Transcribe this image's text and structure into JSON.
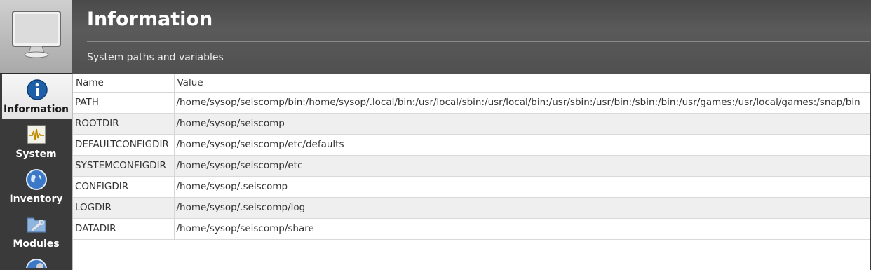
{
  "sidebar": {
    "items": [
      {
        "label": "Information",
        "icon": "info-icon",
        "active": true
      },
      {
        "label": "System",
        "icon": "system-waveform-icon",
        "active": false
      },
      {
        "label": "Inventory",
        "icon": "globe-icon",
        "active": false
      },
      {
        "label": "Modules",
        "icon": "folder-tools-icon",
        "active": false
      },
      {
        "label": "",
        "icon": "globe-gear-icon",
        "active": false
      }
    ]
  },
  "header": {
    "title": "Information",
    "subtitle": "System paths and variables"
  },
  "table": {
    "columns": [
      "Name",
      "Value"
    ],
    "rows": [
      {
        "name": "PATH",
        "value": "/home/sysop/seiscomp/bin:/home/sysop/.local/bin:/usr/local/sbin:/usr/local/bin:/usr/sbin:/usr/bin:/sbin:/bin:/usr/games:/usr/local/games:/snap/bin"
      },
      {
        "name": "ROOTDIR",
        "value": "/home/sysop/seiscomp"
      },
      {
        "name": "DEFAULTCONFIGDIR",
        "value": "/home/sysop/seiscomp/etc/defaults"
      },
      {
        "name": "SYSTEMCONFIGDIR",
        "value": "/home/sysop/seiscomp/etc"
      },
      {
        "name": "CONFIGDIR",
        "value": "/home/sysop/.seiscomp"
      },
      {
        "name": "LOGDIR",
        "value": "/home/sysop/.seiscomp/log"
      },
      {
        "name": "DATADIR",
        "value": "/home/sysop/seiscomp/share"
      }
    ]
  },
  "colors": {
    "accent_blue": "#1f5fa8",
    "header_bg": "#535353",
    "row_alt": "#efefef"
  }
}
